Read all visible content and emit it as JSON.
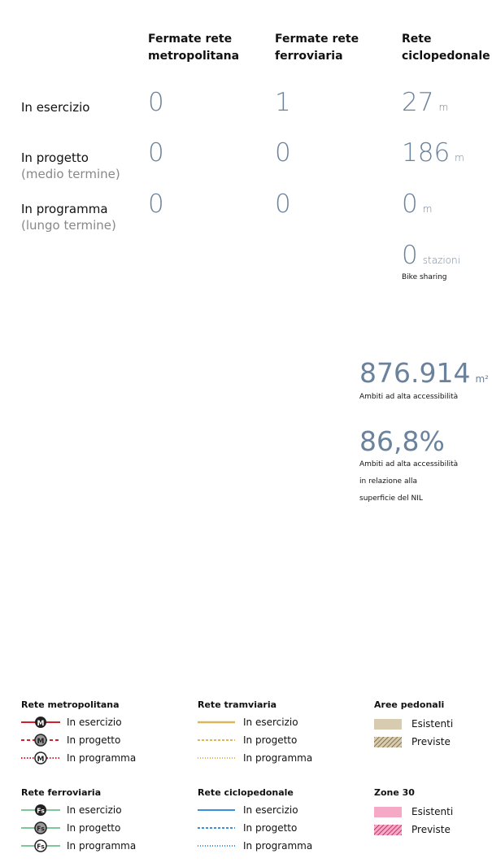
{
  "columns": {
    "metro": [
      "Fermate rete",
      "metropolitana"
    ],
    "ferro": [
      "Fermate rete",
      "ferroviaria"
    ],
    "ciclo": [
      "Rete",
      "ciclopedonale"
    ]
  },
  "rows": [
    {
      "label": "In esercizio",
      "sub": "",
      "metro": "0",
      "ferro": "1",
      "ciclo": "27",
      "ciclo_unit": "m"
    },
    {
      "label": "In progetto",
      "sub": "(medio termine)",
      "metro": "0",
      "ferro": "0",
      "ciclo": "186",
      "ciclo_unit": "m"
    },
    {
      "label": "In programma",
      "sub": "(lungo termine)",
      "metro": "0",
      "ferro": "0",
      "ciclo": "0",
      "ciclo_unit": "m"
    }
  ],
  "bike_sharing": {
    "value": "0",
    "unit": "stazioni",
    "label": "Bike sharing"
  },
  "accessibility_area": {
    "value": "876.914",
    "unit": "m²",
    "label": "Ambiti ad alta accessibilità"
  },
  "accessibility_pct": {
    "value": "86,8%",
    "label_lines": [
      "Ambiti ad alta accessibilità",
      "in relazione alla",
      "superficie del NIL"
    ]
  },
  "legend": {
    "metro": {
      "title": "Rete metropolitana",
      "items": [
        "In esercizio",
        "In progetto",
        "In programma"
      ],
      "symbol": "M",
      "color": "#d0212f"
    },
    "tram": {
      "title": "Rete tramviaria",
      "items": [
        "In esercizio",
        "In progetto",
        "In programma"
      ],
      "color": "#d9b75a"
    },
    "pedonali": {
      "title": "Aree pedonali",
      "items": [
        "Esistenti",
        "Previste"
      ],
      "color": "#d8ccb0"
    },
    "ferro": {
      "title": "Rete ferroviaria",
      "items": [
        "In esercizio",
        "In progetto",
        "In programma"
      ],
      "symbol": "Fs",
      "color": "#7fc79a"
    },
    "ciclo": {
      "title": "Rete ciclopedonale",
      "items": [
        "In esercizio",
        "In progetto",
        "In programma"
      ],
      "color": "#3c8fdc"
    },
    "zone30": {
      "title": "Zone 30",
      "items": [
        "Esistenti",
        "Previste"
      ],
      "color": "#f5a9c6"
    }
  }
}
